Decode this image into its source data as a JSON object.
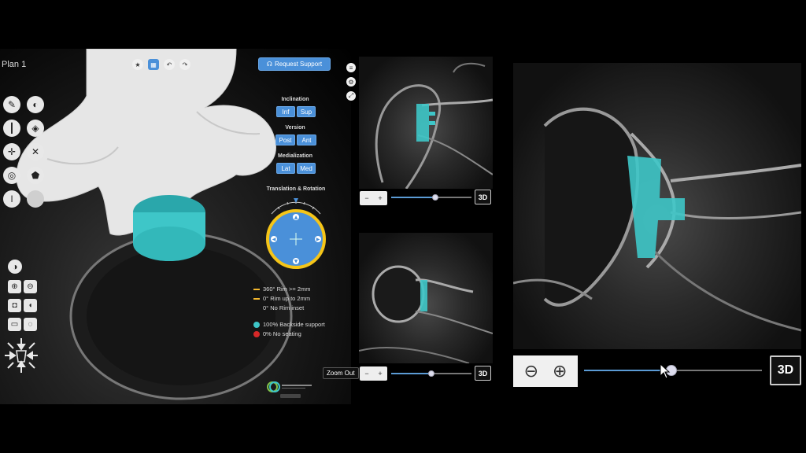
{
  "plan": {
    "title": "Plan 1"
  },
  "toolbar_top": {
    "icons": [
      "star-icon",
      "grid-icon",
      "undo-icon",
      "redo-icon"
    ]
  },
  "support": {
    "label": "Request Support"
  },
  "controls": {
    "inclination": {
      "label": "Inclination",
      "inf": "Inf",
      "sup": "Sup"
    },
    "version": {
      "label": "Version",
      "post": "Post",
      "ant": "Ant"
    },
    "medialization": {
      "label": "Medialization",
      "lat": "Lat",
      "med": "Med"
    },
    "translation": {
      "label": "Translation & Rotation"
    }
  },
  "legend": {
    "rim_full": "360° Rim >= 2mm",
    "rim_partial": "0° Rim up to 2mm",
    "no_rim": "0° No Rim inset",
    "backside": "100% Backside support",
    "no_seating": "0% No seating"
  },
  "colors": {
    "accent_blue": "#4a90d9",
    "implant_teal": "#3ec6c8",
    "rim_yellow": "#f5b82e",
    "no_seating_red": "#d62828",
    "backside_teal": "#3ec6c8"
  },
  "ct_top": {
    "view_3d": "3D",
    "slider": 0.55
  },
  "ct_bottom": {
    "zoom_out": "Zoom Out",
    "view_3d": "3D",
    "slider": 0.5
  },
  "ct_main": {
    "view_3d": "3D",
    "slider": 0.49
  }
}
